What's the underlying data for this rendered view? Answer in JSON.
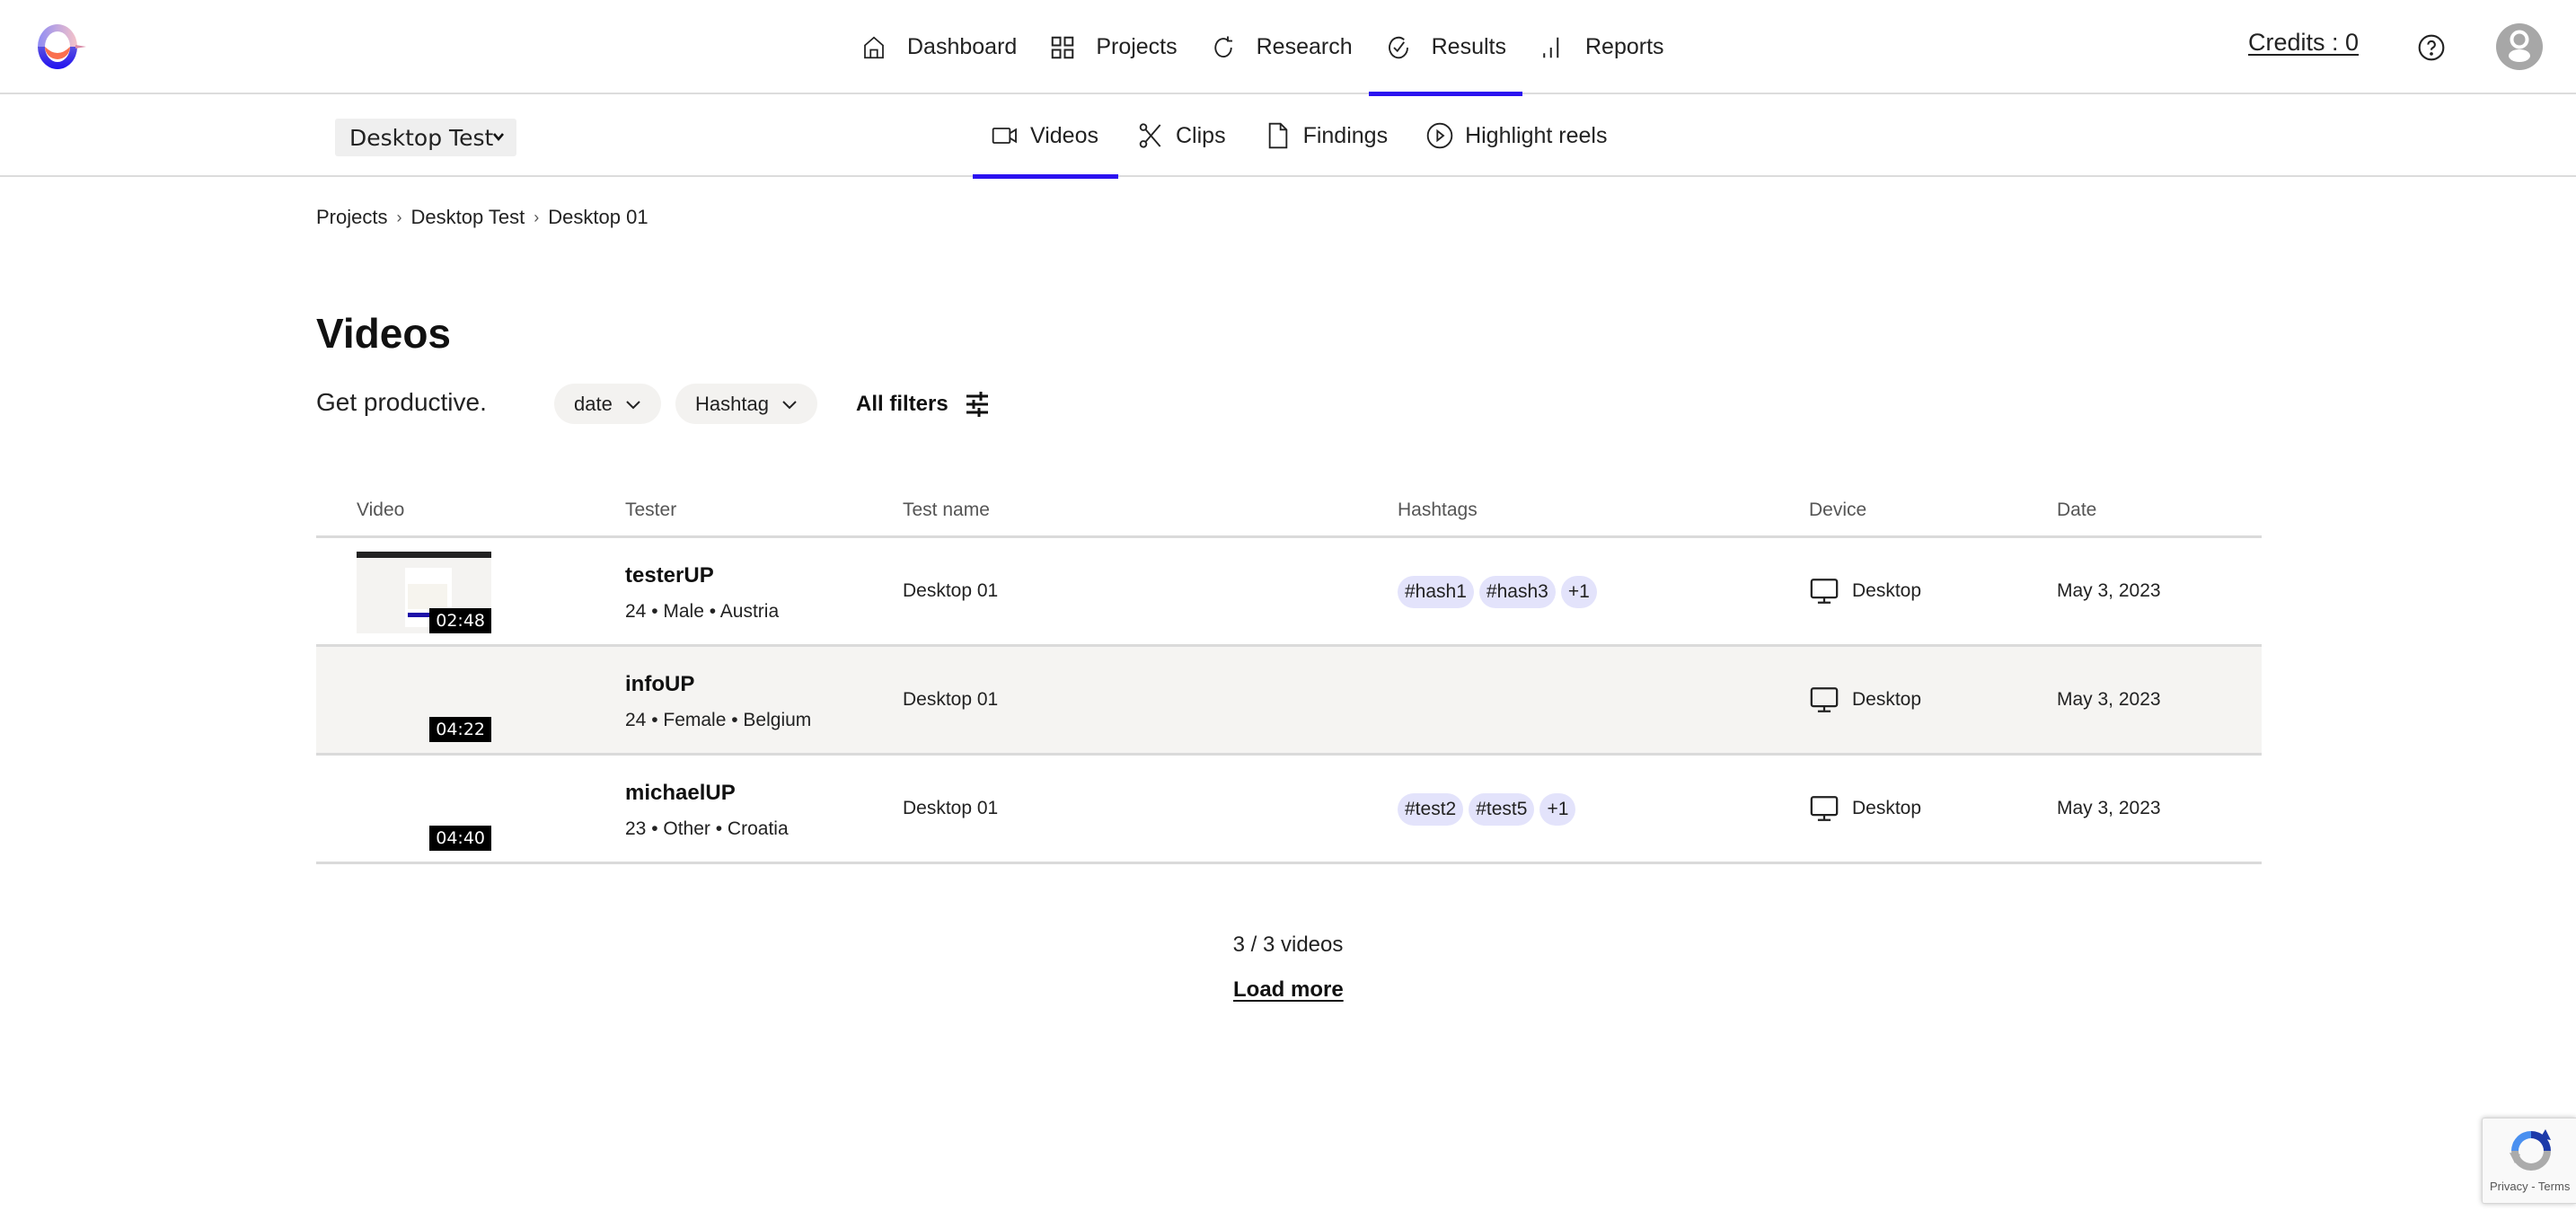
{
  "header": {
    "logo": "app-logo",
    "nav": [
      {
        "label": "Dashboard",
        "icon": "home-icon",
        "active": false
      },
      {
        "label": "Projects",
        "icon": "grid-icon",
        "active": false
      },
      {
        "label": "Research",
        "icon": "refresh-icon",
        "active": false
      },
      {
        "label": "Results",
        "icon": "check-circle-icon",
        "active": true
      },
      {
        "label": "Reports",
        "icon": "bar-chart-icon",
        "active": false
      }
    ],
    "credits_label": "Credits : 0",
    "accent_color": "#2b12f0"
  },
  "subnav": {
    "project_select": {
      "selected": "Desktop Test"
    },
    "tabs": [
      {
        "label": "Videos",
        "icon": "video-camera-icon",
        "active": true
      },
      {
        "label": "Clips",
        "icon": "scissors-icon",
        "active": false
      },
      {
        "label": "Findings",
        "icon": "document-icon",
        "active": false
      },
      {
        "label": "Highlight reels",
        "icon": "play-circle-icon",
        "active": false
      }
    ]
  },
  "breadcrumb": [
    "Projects",
    "Desktop Test",
    "Desktop 01"
  ],
  "page": {
    "title": "Videos",
    "subtitle": "Get productive.",
    "filters": [
      {
        "label": "date"
      },
      {
        "label": "Hashtag"
      }
    ],
    "all_filters_label": "All filters"
  },
  "table": {
    "columns": [
      "Video",
      "Tester",
      "Test name",
      "Hashtags",
      "Device",
      "Date"
    ],
    "rows": [
      {
        "duration": "02:48",
        "has_thumbnail": true,
        "tester": "testerUP",
        "meta": "24 • Male • Austria",
        "test_name": "Desktop 01",
        "hashtags": [
          "#hash1",
          "#hash3",
          "+1"
        ],
        "device": "Desktop",
        "date": "May 3, 2023"
      },
      {
        "duration": "04:22",
        "has_thumbnail": false,
        "tester": "infoUP",
        "meta": "24 • Female • Belgium",
        "test_name": "Desktop 01",
        "hashtags": [],
        "device": "Desktop",
        "date": "May 3, 2023"
      },
      {
        "duration": "04:40",
        "has_thumbnail": false,
        "tester": "michaelUP",
        "meta": "23 • Other • Croatia",
        "test_name": "Desktop 01",
        "hashtags": [
          "#test2",
          "#test5",
          "+1"
        ],
        "device": "Desktop",
        "date": "May 3, 2023"
      }
    ]
  },
  "footer": {
    "count_label": "3 / 3 videos",
    "load_more_label": "Load more"
  },
  "recaptcha": {
    "links": "Privacy - Terms"
  }
}
